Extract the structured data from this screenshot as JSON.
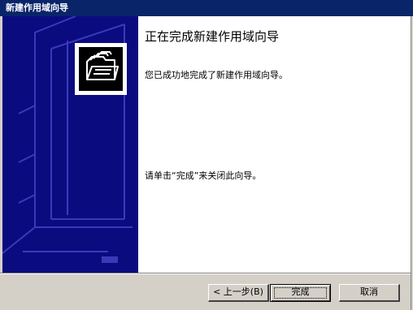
{
  "window": {
    "title": "新建作用域向导"
  },
  "content": {
    "heading": "正在完成新建作用域向导",
    "message": "您已成功地完成了新建作用域向导。",
    "instruction": "请单击“完成”来关闭此向导。"
  },
  "icons": {
    "wizard_icon": "folder-stack-icon"
  },
  "buttons": {
    "back_label": "< 上一步(B)",
    "finish_label": "完成",
    "cancel_label": "取消"
  },
  "colors": {
    "titlebar": "#0a246a",
    "side_panel": "#0b0b80",
    "dialog_face": "#d4d0c8"
  }
}
